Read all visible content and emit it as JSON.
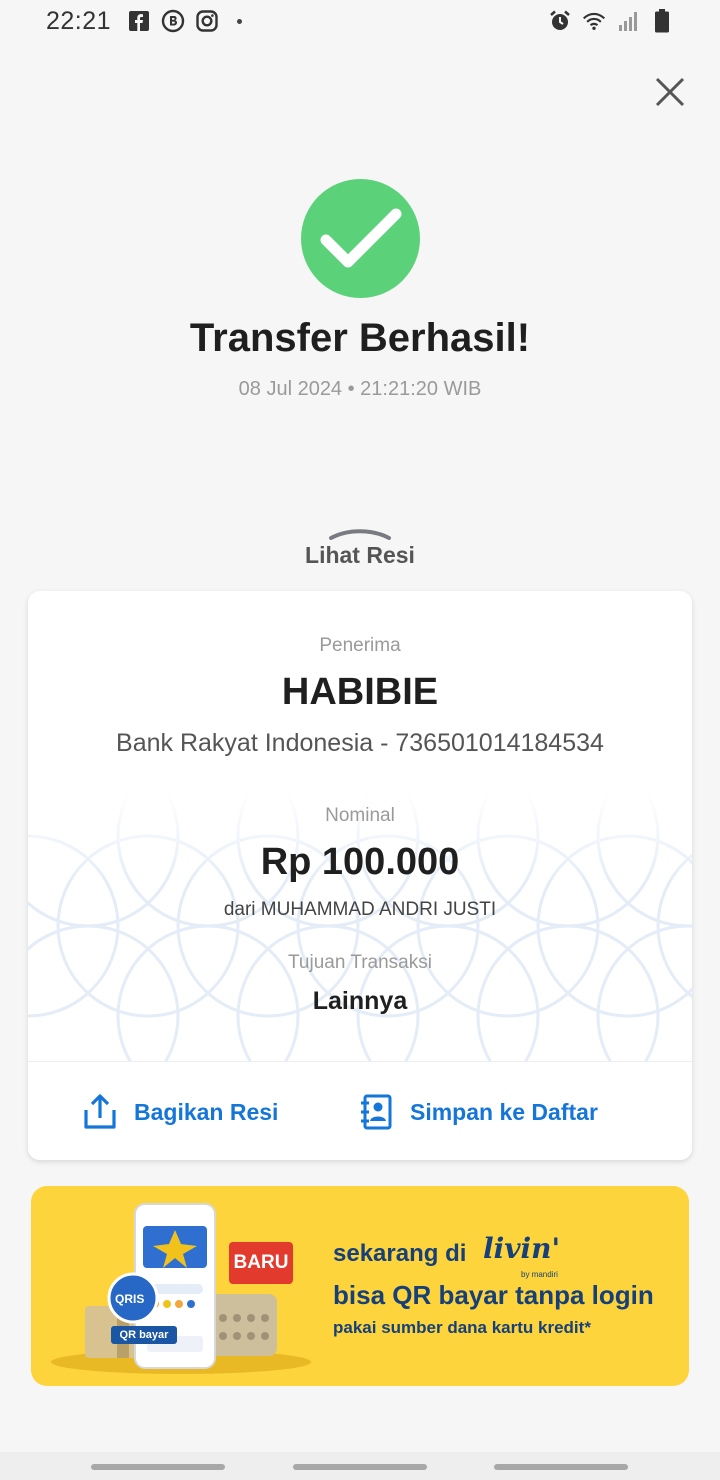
{
  "status_bar": {
    "time": "22:21",
    "left_icons": [
      "facebook-icon",
      "b-app-icon",
      "instagram-icon"
    ],
    "right_icons": [
      "alarm-icon",
      "wifi-icon",
      "signal-icon",
      "battery-icon"
    ]
  },
  "header": {
    "close_icon": "close-icon"
  },
  "result": {
    "title": "Transfer Berhasil!",
    "datetime": "08 Jul 2024 • 21:21:20 WIB",
    "icon": "check-circle-icon",
    "color": "#5bd27a"
  },
  "receipt_toggle": {
    "label": "Lihat Resi"
  },
  "receipt": {
    "recipient_label": "Penerima",
    "recipient_name": "HABIBIE",
    "recipient_bank": "Bank Rakyat Indonesia - 736501014184534",
    "amount_label": "Nominal",
    "amount": "Rp 100.000",
    "sender": "dari MUHAMMAD ANDRI JUSTI",
    "purpose_label": "Tujuan Transaksi",
    "purpose": "Lainnya"
  },
  "actions": {
    "share_label": "Bagikan Resi",
    "save_label": "Simpan ke Daftar",
    "accent": "#1476d8"
  },
  "banner": {
    "badge": "BARU",
    "qris_text": "QRIS",
    "qris_button": "QR bayar",
    "line1": "sekarang di",
    "brand": "livin'",
    "brand_sub": "by mandiri",
    "line2": "bisa QR bayar tanpa login",
    "line3": "pakai sumber dana kartu kredit*",
    "background": "#fdd43c"
  }
}
